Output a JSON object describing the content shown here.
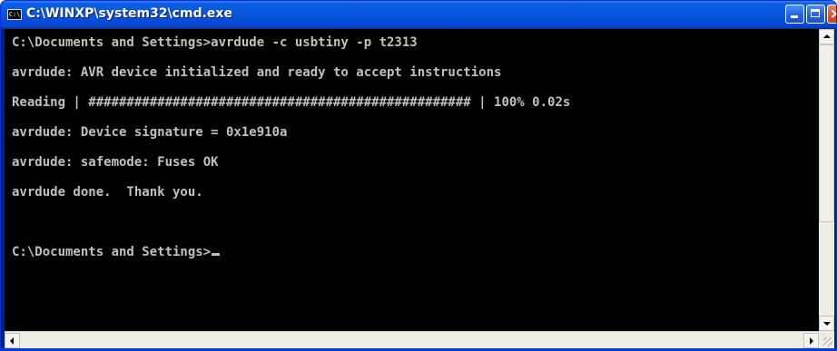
{
  "window": {
    "title": "C:\\WINXP\\system32\\cmd.exe",
    "icon_label": "C:\\",
    "icon": "console-app-icon",
    "buttons": {
      "minimize_icon": "minimize-icon",
      "maximize_icon": "maximize-icon",
      "close_icon": "close-icon"
    }
  },
  "console": {
    "text_color": "#c0c0c0",
    "background": "#000000",
    "lines": [
      "C:\\Documents and Settings>avrdude -c usbtiny -p t2313",
      "avrdude: AVR device initialized and ready to accept instructions",
      "Reading | ################################################## | 100% 0.02s",
      "avrdude: Device signature = 0x1e910a",
      "avrdude: safemode: Fuses OK",
      "avrdude done.  Thank you.",
      "",
      "C:\\Documents and Settings>"
    ]
  },
  "scrollbars": {
    "vertical": {
      "up_icon": "scroll-up-arrow-icon",
      "down_icon": "scroll-down-arrow-icon"
    },
    "horizontal": {
      "left_icon": "scroll-left-arrow-icon",
      "right_icon": "scroll-right-arrow-icon"
    }
  }
}
